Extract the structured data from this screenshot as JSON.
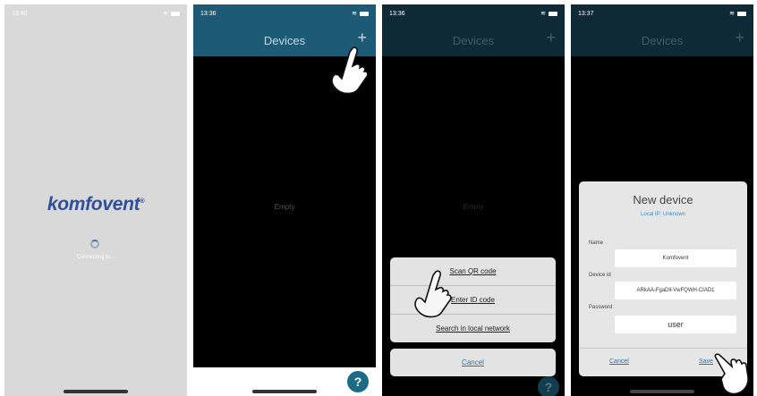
{
  "screens": [
    {
      "status_time": "13:40",
      "logo": "komfovent",
      "logo_mark": "®",
      "connecting_text": "Connecting to..."
    },
    {
      "status_time": "13:36",
      "title": "Devices",
      "add_symbol": "+",
      "empty_text": "Empty",
      "help_symbol": "?"
    },
    {
      "status_time": "13:36",
      "title": "Devices",
      "add_symbol": "+",
      "empty_text": "Empty",
      "help_symbol": "?",
      "sheet_options": [
        "Scan QR code",
        "Enter ID code",
        "Search in local network"
      ],
      "cancel_label": "Cancel"
    },
    {
      "status_time": "13:37",
      "title": "Devices",
      "add_symbol": "+",
      "dialog": {
        "title": "New device",
        "subtitle": "Local IP: Unknown",
        "name_label": "Name",
        "name_value": "Komfovent",
        "device_id_label": "Device id",
        "device_id_value": "ARkAA-FgaDll-VwFQWH-CIAD1",
        "password_label": "Password",
        "password_value": "user",
        "cancel_label": "Cancel",
        "save_label": "Save"
      }
    }
  ],
  "colors": {
    "header_blue": "#1d5a75",
    "link_blue": "#2a72b5",
    "logo_blue": "#2f4e9c",
    "splash_bg": "#d9d9d9"
  }
}
